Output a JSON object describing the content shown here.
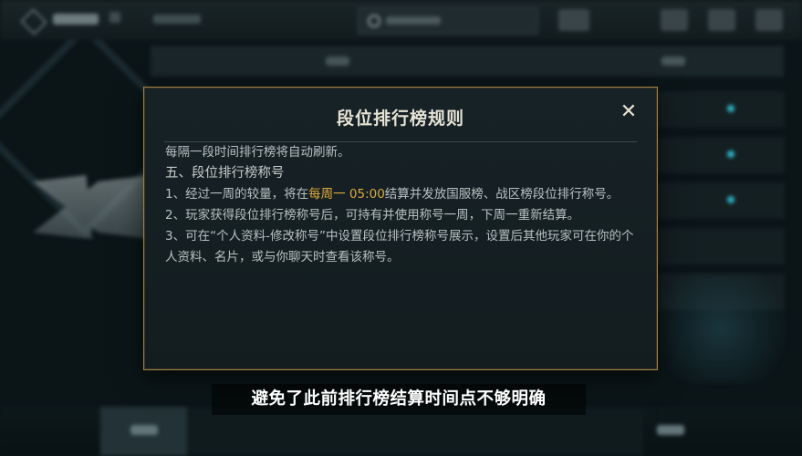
{
  "modal": {
    "title": "段位排行榜规则",
    "close_label": "✕",
    "top_line": "每隔一段时间排行榜将自动刷新。",
    "section_heading": "五、段位排行榜称号",
    "items": {
      "item1_before": "1、经过一周的较量，将在",
      "item1_highlight": "每周一 05:00",
      "item1_after": "结算并发放国服榜、战区榜段位排行称号。",
      "item2": "2、玩家获得段位排行榜称号后，可持有并使用称号一周，下周一重新结算。",
      "item3": "3、可在“个人资料-修改称号”中设置段位排行榜称号展示，设置后其他玩家可在你的个人资料、名片，或与你聊天时查看该称号。"
    }
  },
  "subtitle": "避免了此前排行榜结算时间点不够明确",
  "colors": {
    "highlight": "#e0aa3a",
    "modal_border": "#9c8346",
    "background": "#0b1518"
  },
  "icons": {
    "close": "close-icon"
  }
}
